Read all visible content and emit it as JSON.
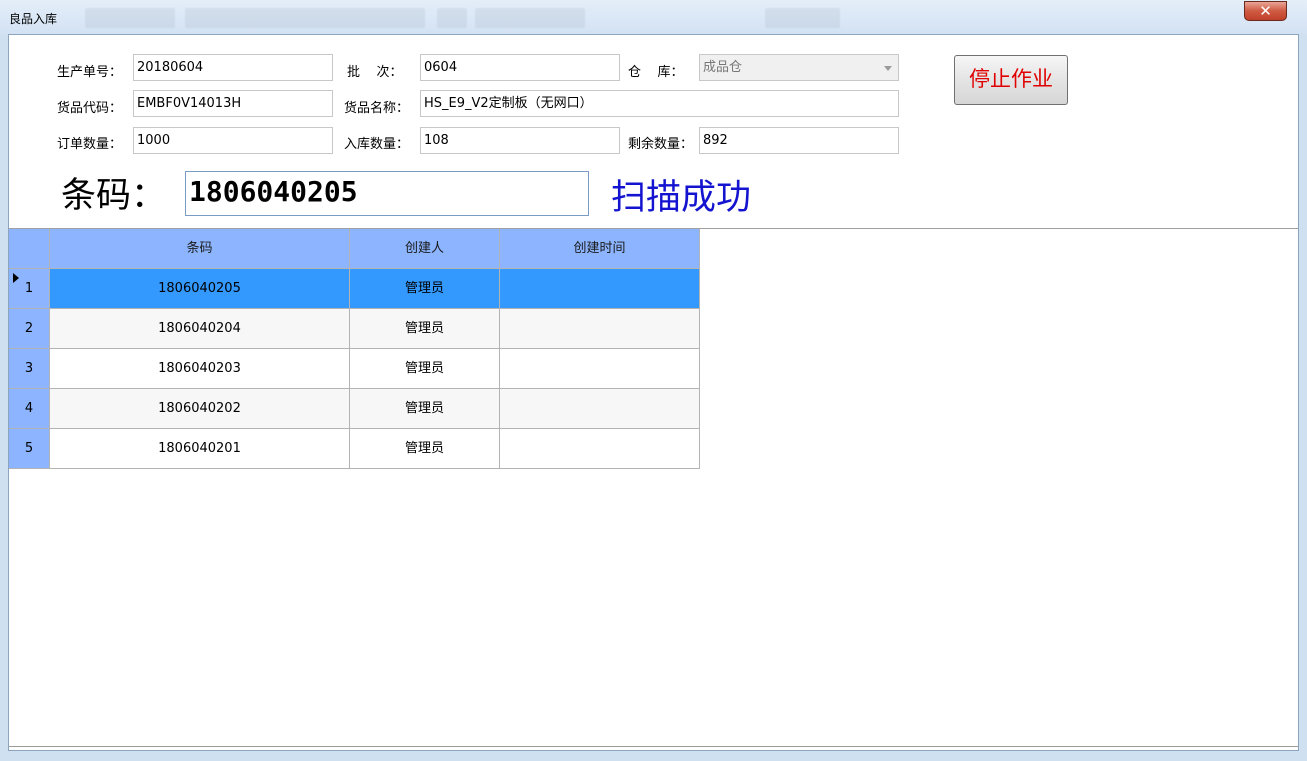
{
  "window": {
    "title": "良品入库",
    "close_symbol": "✕"
  },
  "form": {
    "production_no": {
      "label": "生产单号：",
      "value": "20180604"
    },
    "batch": {
      "label": "批    次：",
      "value": "0604"
    },
    "warehouse": {
      "label": "仓    库：",
      "value": "成品仓"
    },
    "goods_code": {
      "label": "货品代码：",
      "value": "EMBF0V14013H"
    },
    "goods_name": {
      "label": "货品名称：",
      "value": "HS_E9_V2定制板（无网口）"
    },
    "order_qty": {
      "label": "订单数量：",
      "value": "1000"
    },
    "stock_in_qty": {
      "label": "入库数量：",
      "value": "108"
    },
    "remaining_qty": {
      "label": "剩余数量：",
      "value": "892"
    },
    "stop_button": "停止作业"
  },
  "scan": {
    "label": "条码：",
    "value": "1806040205",
    "status": "扫描成功",
    "status_color": "#1414d0"
  },
  "grid": {
    "columns": [
      "条码",
      "创建人",
      "创建时间"
    ],
    "rows": [
      {
        "no": "1",
        "barcode": "1806040205",
        "creator": "管理员",
        "created_at": ""
      },
      {
        "no": "2",
        "barcode": "1806040204",
        "creator": "管理员",
        "created_at": ""
      },
      {
        "no": "3",
        "barcode": "1806040203",
        "creator": "管理员",
        "created_at": ""
      },
      {
        "no": "4",
        "barcode": "1806040202",
        "creator": "管理员",
        "created_at": ""
      },
      {
        "no": "5",
        "barcode": "1806040201",
        "creator": "管理员",
        "created_at": ""
      }
    ],
    "selected_row": 0,
    "header_color": "#8cb4ff",
    "selection_color": "#3399ff"
  }
}
